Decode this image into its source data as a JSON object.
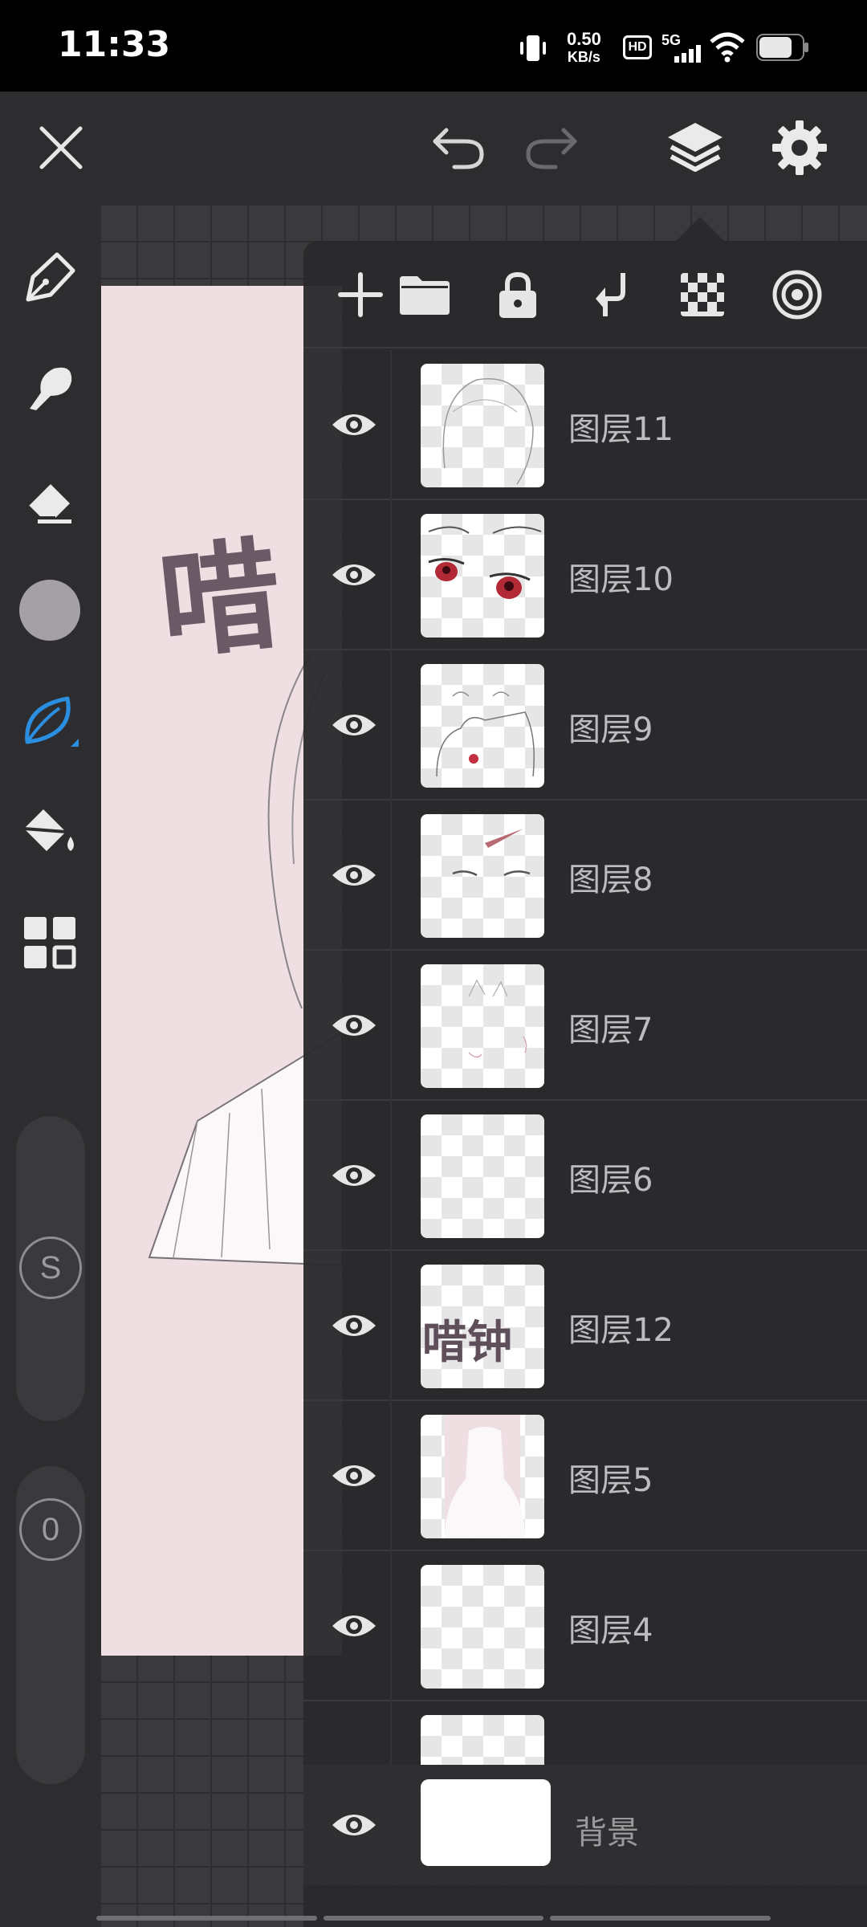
{
  "status_bar": {
    "time": "11:33",
    "net_speed_value": "0.50",
    "net_speed_unit": "KB/s",
    "hd_badge": "HD",
    "network": "5G",
    "icons": [
      "vibrate-icon",
      "wifi-icon",
      "battery-icon"
    ]
  },
  "top_toolbar": {
    "icons": [
      "close-icon",
      "undo-icon",
      "redo-icon",
      "layers-icon",
      "settings-icon"
    ]
  },
  "left_toolbar": {
    "tools": [
      "pen-tool-icon",
      "smudge-tool-icon",
      "eraser-icon",
      "color-swatch",
      "leaf-brush-icon",
      "fill-bucket-icon",
      "grid-menu-icon"
    ],
    "active_color": "#a4a0a4",
    "accent_color": "#2a8fe0",
    "size_label": "S",
    "opacity_label": "0"
  },
  "canvas": {
    "art_text": "唶"
  },
  "layers_panel": {
    "toolbar_icons": [
      "add-layer-icon",
      "folder-icon",
      "lock-icon",
      "merge-down-icon",
      "transparency-icon",
      "target-icon"
    ],
    "layers": [
      {
        "name": "图层11",
        "visible": true
      },
      {
        "name": "图层10",
        "visible": true
      },
      {
        "name": "图层9",
        "visible": true
      },
      {
        "name": "图层8",
        "visible": true
      },
      {
        "name": "图层7",
        "visible": true
      },
      {
        "name": "图层6",
        "visible": true
      },
      {
        "name": "图层12",
        "visible": true,
        "thumb_text": "唶钟"
      },
      {
        "name": "图层5",
        "visible": true
      },
      {
        "name": "图层4",
        "visible": true
      }
    ],
    "background_layer": {
      "name": "背景",
      "visible": true
    }
  }
}
